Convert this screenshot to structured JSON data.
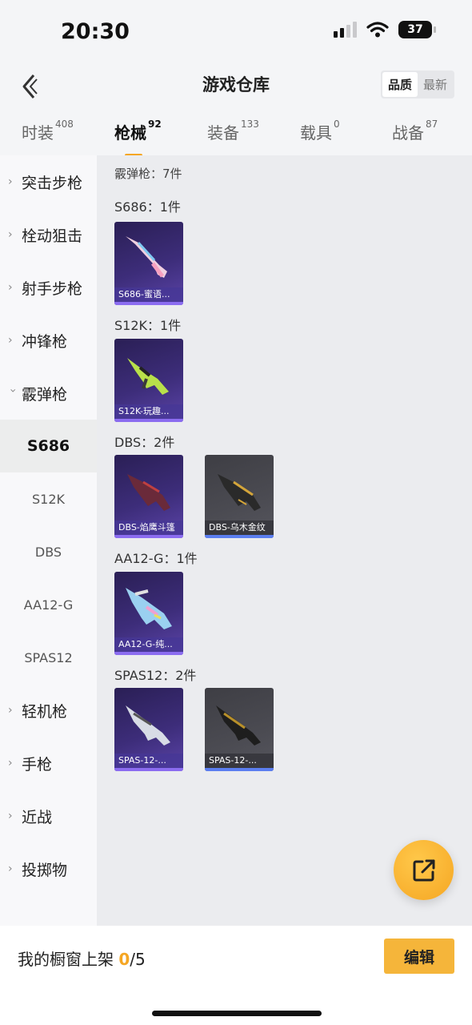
{
  "status_bar": {
    "time": "20:30",
    "battery": "37"
  },
  "header": {
    "title": "游戏仓库",
    "sort_options": [
      "品质",
      "最新"
    ]
  },
  "tabs": [
    {
      "label": "时装",
      "count": "408"
    },
    {
      "label": "枪械",
      "count": "92"
    },
    {
      "label": "装备",
      "count": "133"
    },
    {
      "label": "载具",
      "count": "0"
    },
    {
      "label": "战备",
      "count": "87"
    }
  ],
  "sidebar": {
    "categories": [
      "突击步枪",
      "栓动狙击",
      "射手步枪",
      "冲锋枪",
      "霰弹枪",
      "轻机枪",
      "手枪",
      "近战",
      "投掷物"
    ],
    "sub_items": [
      "S686",
      "S12K",
      "DBS",
      "AA12-G",
      "SPAS12"
    ]
  },
  "main": {
    "category_summary": "霰弹枪：7件",
    "groups": [
      {
        "title": "S686：1件",
        "items": [
          {
            "name": "S686-蜜语...",
            "rarity": "purple"
          }
        ]
      },
      {
        "title": "S12K：1件",
        "items": [
          {
            "name": "S12K-玩趣...",
            "rarity": "purple"
          }
        ]
      },
      {
        "title": "DBS：2件",
        "items": [
          {
            "name": "DBS-焰鹰斗篷",
            "rarity": "purple"
          },
          {
            "name": "DBS-乌木金纹",
            "rarity": "gray"
          }
        ]
      },
      {
        "title": "AA12-G：1件",
        "items": [
          {
            "name": "AA12-G-纯...",
            "rarity": "purple"
          }
        ]
      },
      {
        "title": "SPAS12：2件",
        "items": [
          {
            "name": "SPAS-12-...",
            "rarity": "purple"
          },
          {
            "name": "SPAS-12-...",
            "rarity": "gray"
          }
        ]
      }
    ]
  },
  "bottom_bar": {
    "label": "我的橱窗上架",
    "current": "0",
    "total": "/5",
    "edit_label": "编辑"
  },
  "colors": {
    "accent": "#f5a623",
    "purple_rarity": "#8b6cf0",
    "gray_rarity": "#5b7ef0"
  }
}
